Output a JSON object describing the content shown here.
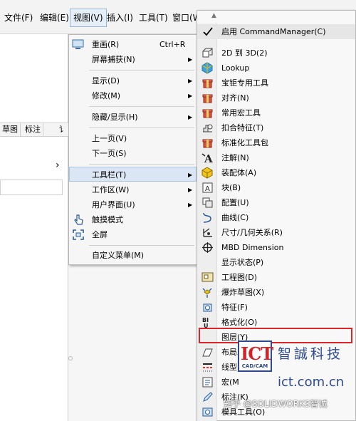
{
  "menubar": {
    "items": [
      {
        "label": "文件(F)"
      },
      {
        "label": "编辑(E)"
      },
      {
        "label": "视图(V)"
      },
      {
        "label": "插入(I)"
      },
      {
        "label": "工具(T)"
      },
      {
        "label": "窗口(W"
      }
    ]
  },
  "left_panel": {
    "tabs": [
      "草图",
      "标注",
      "讠"
    ]
  },
  "view_menu": {
    "items": [
      {
        "label": "重画(R)",
        "shortcut": "Ctrl+R",
        "icon": "redraw-icon"
      },
      {
        "label": "屏幕捕获(N)",
        "arrow": "▶"
      },
      {
        "label": "显示(D)",
        "arrow": "▶"
      },
      {
        "label": "修改(M)",
        "arrow": "▶"
      },
      {
        "label": "隐藏/显示(H)",
        "arrow": "▶"
      },
      {
        "label": "上一页(V)"
      },
      {
        "label": "下一页(S)"
      },
      {
        "label": "工具栏(T)",
        "arrow": "▶",
        "highlighted": true
      },
      {
        "label": "工作区(W)",
        "arrow": "▶"
      },
      {
        "label": "用户界面(U)",
        "arrow": "▶"
      },
      {
        "label": "触摸模式",
        "icon": "touch-mode-icon"
      },
      {
        "label": "全屏",
        "icon": "fullscreen-icon"
      },
      {
        "label": "自定义菜单(M)"
      }
    ]
  },
  "toolbar_menu": {
    "scroll_up": "▲",
    "items": [
      {
        "label": "启用 CommandManager(C)",
        "icon": "checkmark-icon",
        "checked": true
      },
      {
        "label": "2D 到 3D(2)",
        "icon": "2d-to-3d-icon"
      },
      {
        "label": "Lookup",
        "icon": "lookup-icon"
      },
      {
        "label": "宝钜专用工具",
        "icon": "gift-box-icon"
      },
      {
        "label": "对齐(N)",
        "icon": "align-icon"
      },
      {
        "label": "常用宏工具",
        "icon": "macro-tools-icon"
      },
      {
        "label": "扣合特征(T)",
        "icon": "fastening-feature-icon"
      },
      {
        "label": "标准化工具包",
        "icon": "standard-toolbox-icon"
      },
      {
        "label": "注解(N)",
        "icon": "annotation-icon"
      },
      {
        "label": "装配体(A)",
        "icon": "assembly-icon"
      },
      {
        "label": "块(B)",
        "icon": "block-icon"
      },
      {
        "label": "配置(U)",
        "icon": "configuration-icon"
      },
      {
        "label": "曲线(C)",
        "icon": "curve-icon"
      },
      {
        "label": "尺寸/几何关系(R)",
        "icon": "dimension-relation-icon"
      },
      {
        "label": "MBD Dimension",
        "icon": "mbd-dimension-icon"
      },
      {
        "label": "显示状态(P)",
        "icon": ""
      },
      {
        "label": "工程图(D)",
        "icon": "drawing-icon"
      },
      {
        "label": "爆炸草图(X)",
        "icon": "explode-sketch-icon"
      },
      {
        "label": "特征(F)",
        "icon": "feature-icon"
      },
      {
        "label": "格式化(O)",
        "icon": "format-icon"
      },
      {
        "label": "图层(Y)",
        "icon": "",
        "highlighted": true
      },
      {
        "label": "布局工具(O)",
        "icon": "layout-tools-icon"
      },
      {
        "label": "线型(",
        "icon": "line-format-icon"
      },
      {
        "label": "宏(M",
        "icon": "macro-icon"
      },
      {
        "label": "标注(K)",
        "icon": "markup-icon"
      },
      {
        "label": "模具工具(O)",
        "icon": "mold-tools-icon"
      }
    ]
  },
  "watermark": {
    "logo_text": "ICT",
    "logo_sub": "CAD/CAM",
    "company": "智誠科技",
    "url": "ict.com.cn",
    "credit": "知乎 @SOLIDWORKS智诚"
  },
  "colors": {
    "highlight_border": "#d8262b",
    "menu_hover": "#dbe6f4",
    "brand_blue": "#2e4a8c",
    "brand_red": "#d2232a"
  }
}
